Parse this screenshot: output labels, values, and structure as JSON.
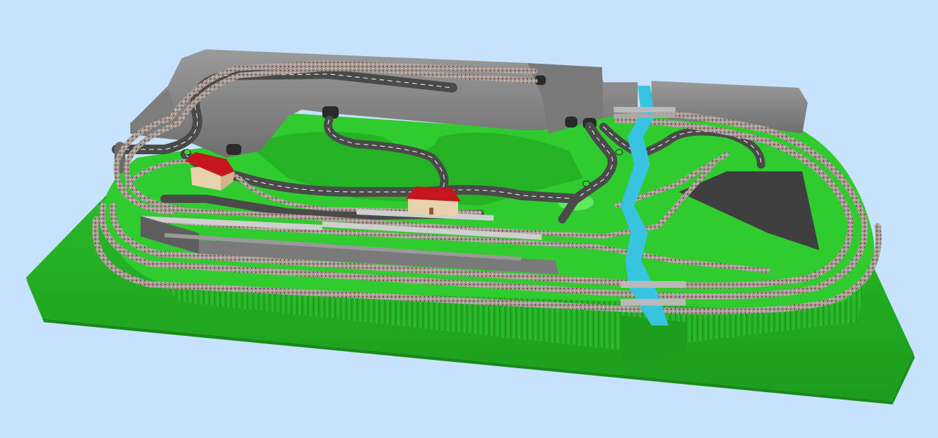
{
  "scene": {
    "colors": {
      "background": "#c6e2fd",
      "grass": "#2ecc2e",
      "grass_dark": "#1fa51f",
      "grass_light": "#55e055",
      "rock": "#8a8a8a",
      "rock_dark": "#6e6e6e",
      "rock_light": "#a3a3a3",
      "road": "#4a4a4a",
      "road_line": "#ffffff",
      "track_bed": "#9c8f86",
      "track_rail": "#5a3a36",
      "water": "#38c3e0",
      "roof": "#c4161c",
      "wall": "#e8d2ad",
      "platform": "#c9c9c9",
      "concrete": "#7d7d7d"
    },
    "objects": [
      {
        "name": "station-building-left",
        "kind": "building"
      },
      {
        "name": "station-building-center",
        "kind": "building"
      },
      {
        "name": "river",
        "kind": "water"
      },
      {
        "name": "mountain-ridge",
        "kind": "terrain"
      }
    ]
  }
}
